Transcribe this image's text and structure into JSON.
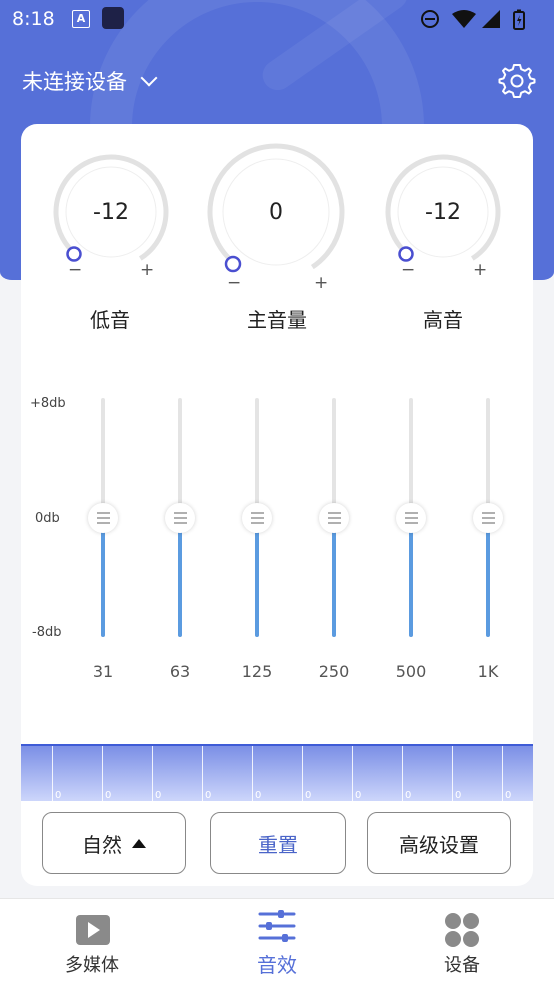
{
  "status_bar": {
    "time": "8:18",
    "notif_letter": "A"
  },
  "header": {
    "device_label": "未连接设备"
  },
  "knobs": [
    {
      "label": "低音",
      "value": "-12",
      "minus": "−",
      "plus": "+"
    },
    {
      "label": "主音量",
      "value": "0",
      "minus": "−",
      "plus": "+"
    },
    {
      "label": "高音",
      "value": "-12",
      "minus": "−",
      "plus": "+"
    }
  ],
  "equalizer": {
    "db_labels": [
      "+8db",
      "0db",
      "-8db"
    ],
    "bands": [
      {
        "freq": "31",
        "gain_db": 0
      },
      {
        "freq": "63",
        "gain_db": 0
      },
      {
        "freq": "125",
        "gain_db": 0
      },
      {
        "freq": "250",
        "gain_db": 0
      },
      {
        "freq": "500",
        "gain_db": 0
      },
      {
        "freq": "1K",
        "gain_db": 0
      }
    ]
  },
  "spectrum": {
    "values": [
      "0",
      "0",
      "0",
      "0",
      "0",
      "0",
      "0",
      "0",
      "0",
      "0"
    ]
  },
  "buttons": {
    "preset": "自然",
    "reset": "重置",
    "advanced": "高级设置"
  },
  "colors": {
    "accent": "#5670d8",
    "slider_fill": "#5b9be0",
    "reset_text": "#4a64c8"
  },
  "nav": [
    {
      "label": "多媒体",
      "icon": "play-icon",
      "active": false
    },
    {
      "label": "音效",
      "icon": "sliders-icon",
      "active": true
    },
    {
      "label": "设备",
      "icon": "grid-icon",
      "active": false
    }
  ]
}
